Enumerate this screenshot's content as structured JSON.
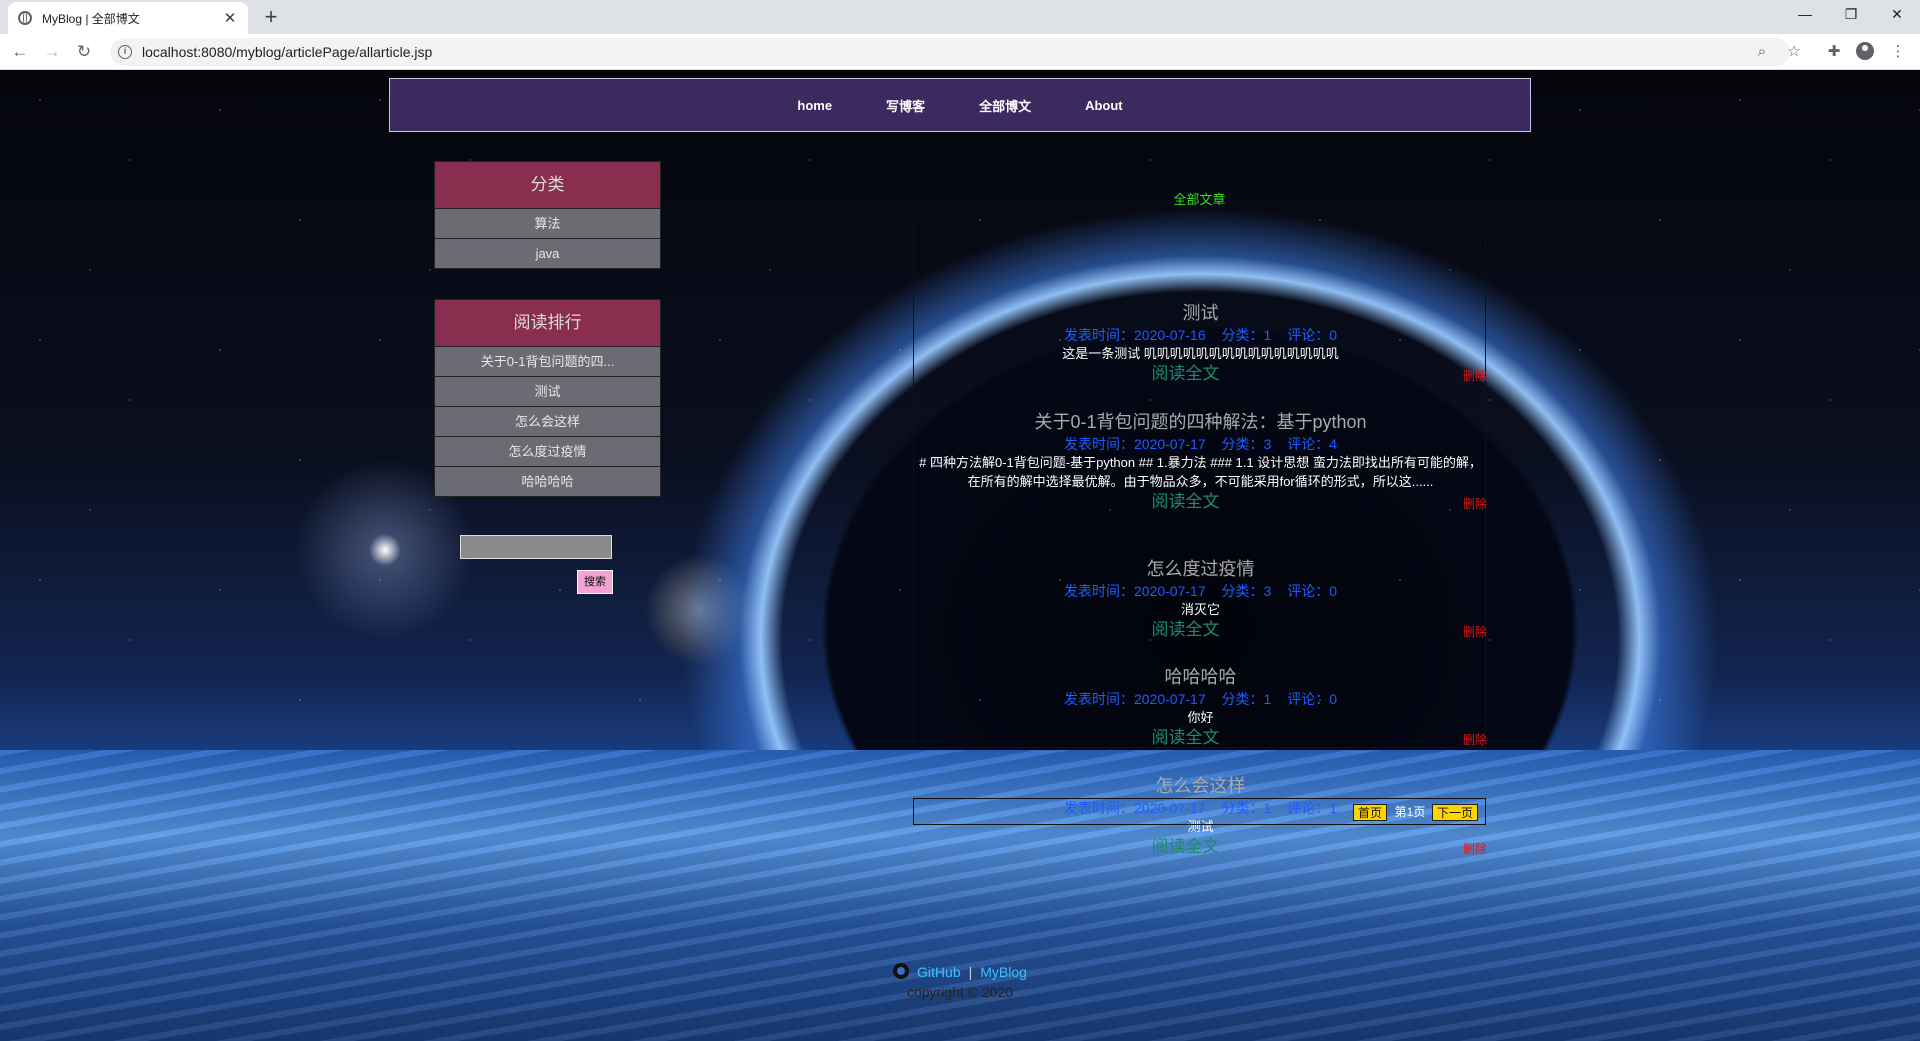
{
  "browser": {
    "tab_title": "MyBlog | 全部博文",
    "tab_close": "✕",
    "new_tab": "+",
    "url": "localhost:8080/myblog/articlePage/allarticle.jsp",
    "window_controls": {
      "minimize": "—",
      "maximize": "❐",
      "close": "✕"
    }
  },
  "nav": {
    "items": [
      "home",
      "写博客",
      "全部博文",
      "About"
    ]
  },
  "sidebar": {
    "category_title": "分类",
    "categories": [
      "算法",
      "java"
    ],
    "ranking_title": "阅读排行",
    "ranking": [
      "关于0-1背包问题的四...",
      "测试",
      "怎么会这样",
      "怎么度过疫情",
      "哈哈哈哈"
    ],
    "search_button": "搜索"
  },
  "main": {
    "heading": "全部文章",
    "articles": [
      {
        "title": "测试",
        "meta_time": "发表时间：2020-07-16",
        "meta_category": "分类：1",
        "meta_comments": "评论：0",
        "body": "这是一条测试 叽叽叽叽叽叽叽叽叽叽叽叽叽叽叽",
        "read_more": "阅读全文",
        "delete": "删除"
      },
      {
        "title": "关于0-1背包问题的四种解法：基于python",
        "meta_time": "发表时间：2020-07-17",
        "meta_category": "分类：3",
        "meta_comments": "评论：4",
        "body": "# 四种方法解0-1背包问题-基于python ## 1.暴力法 ### 1.1 设计思想 蛮力法即找出所有可能的解，在所有的解中选择最优解。由于物品众多，不可能采用for循环的形式，所以这......",
        "read_more": "阅读全文",
        "delete": "删除"
      },
      {
        "title": "怎么度过疫情",
        "meta_time": "发表时间：2020-07-17",
        "meta_category": "分类：3",
        "meta_comments": "评论：0",
        "body": "消灭它",
        "read_more": "阅读全文",
        "delete": "删除"
      },
      {
        "title": "哈哈哈哈",
        "meta_time": "发表时间：2020-07-17",
        "meta_category": "分类：1",
        "meta_comments": "评论：0",
        "body": "你好",
        "read_more": "阅读全文",
        "delete": "删除"
      },
      {
        "title": "怎么会这样",
        "meta_time": "发表时间：2020-07-17",
        "meta_category": "分类：1",
        "meta_comments": "评论：1",
        "body": "测试",
        "read_more": "阅读全文",
        "delete": "删除"
      }
    ],
    "pager": {
      "first": "首页",
      "current": "第1页",
      "next": "下一页"
    }
  },
  "footer": {
    "github": "GitHub",
    "separator": "|",
    "myblog": "MyBlog",
    "copyright": "copyright © 2020"
  }
}
